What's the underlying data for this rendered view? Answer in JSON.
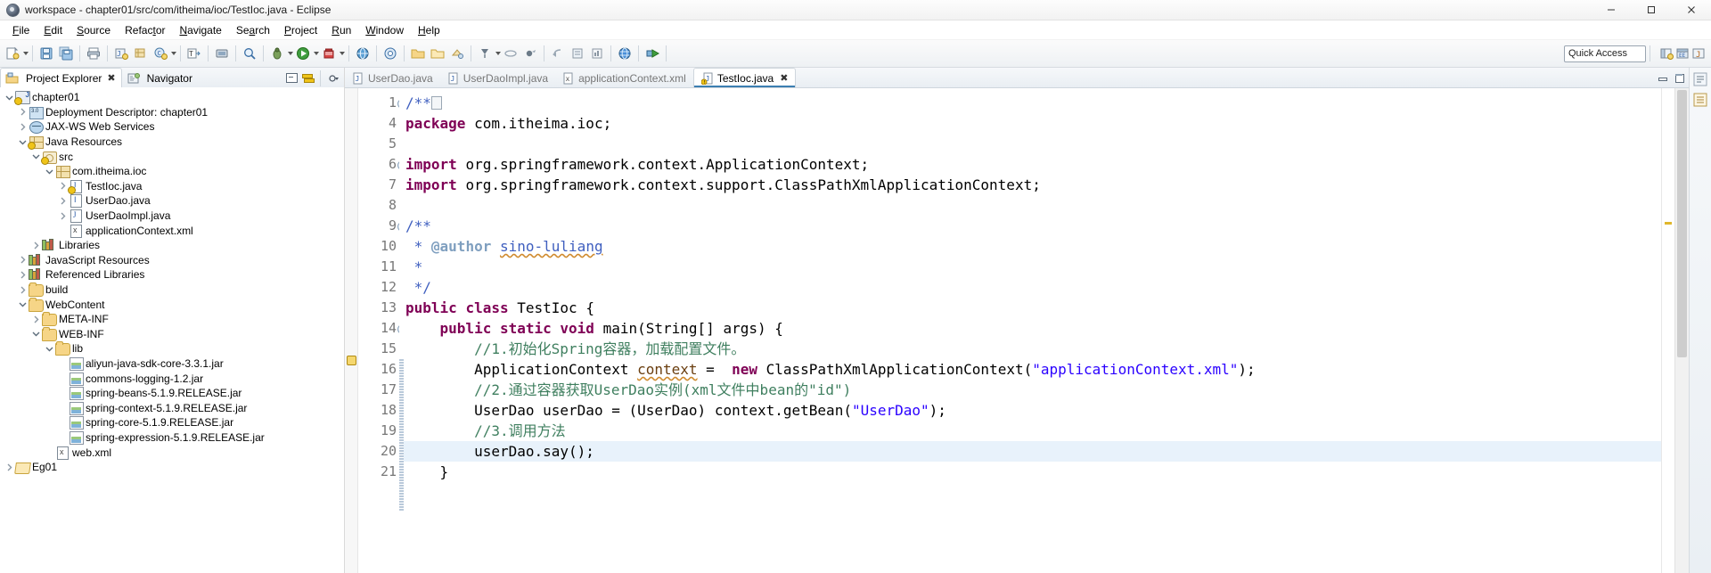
{
  "window": {
    "title": "workspace - chapter01/src/com/itheima/ioc/TestIoc.java - Eclipse",
    "app_icon": "eclipse-icon",
    "minimize_label": "Minimize",
    "maximize_label": "Maximize",
    "close_label": "Close"
  },
  "menubar": {
    "items": [
      {
        "label": "File",
        "mnemonic": "F"
      },
      {
        "label": "Edit",
        "mnemonic": "E"
      },
      {
        "label": "Source",
        "mnemonic": "S"
      },
      {
        "label": "Refactor",
        "mnemonic": "t"
      },
      {
        "label": "Navigate",
        "mnemonic": "N"
      },
      {
        "label": "Search",
        "mnemonic": "a"
      },
      {
        "label": "Project",
        "mnemonic": "P"
      },
      {
        "label": "Run",
        "mnemonic": "R"
      },
      {
        "label": "Window",
        "mnemonic": "W"
      },
      {
        "label": "Help",
        "mnemonic": "H"
      }
    ]
  },
  "toolbar": {
    "quick_access_placeholder": "Quick Access",
    "buttons": [
      {
        "name": "new-wizard-icon",
        "tooltip": "New"
      },
      {
        "name": "save-icon",
        "tooltip": "Save"
      },
      {
        "name": "save-all-icon",
        "tooltip": "Save All"
      },
      {
        "name": "print-icon",
        "tooltip": "Print"
      },
      {
        "name": "new-java-project-icon",
        "tooltip": "New Java Project"
      },
      {
        "name": "new-class-icon",
        "tooltip": "New Class"
      },
      {
        "name": "open-type-icon",
        "tooltip": "Open Type"
      },
      {
        "name": "build-all-icon",
        "tooltip": "Build All"
      },
      {
        "name": "debug-icon",
        "tooltip": "Debug"
      },
      {
        "name": "run-icon",
        "tooltip": "Run"
      },
      {
        "name": "run-external-tools-icon",
        "tooltip": "External Tools"
      },
      {
        "name": "new-server-icon",
        "tooltip": "New Server"
      },
      {
        "name": "new-ejb-icon",
        "tooltip": "New EJB"
      },
      {
        "name": "new-web-service-icon",
        "tooltip": "New Web Service"
      },
      {
        "name": "open-perspective-icon",
        "tooltip": "Open Perspective"
      },
      {
        "name": "search-icon",
        "tooltip": "Search"
      },
      {
        "name": "next-annotation-icon",
        "tooltip": "Next Annotation"
      },
      {
        "name": "previous-annotation-icon",
        "tooltip": "Previous Annotation"
      },
      {
        "name": "last-edit-location-icon",
        "tooltip": "Last Edit Location"
      },
      {
        "name": "back-icon",
        "tooltip": "Back"
      },
      {
        "name": "forward-icon",
        "tooltip": "Forward"
      }
    ],
    "perspective_icons": [
      {
        "name": "java-ee-perspective-icon"
      },
      {
        "name": "java-perspective-icon"
      },
      {
        "name": "open-perspective-button-icon"
      }
    ]
  },
  "left_panel": {
    "tabs": [
      {
        "label": "Project Explorer",
        "icon": "project-explorer-icon",
        "active": true,
        "closable": true
      },
      {
        "label": "Navigator",
        "icon": "navigator-icon",
        "active": false,
        "closable": false
      }
    ],
    "tab_actions": [
      {
        "name": "collapse-all-icon"
      },
      {
        "name": "link-with-editor-icon"
      },
      {
        "name": "view-menu-icon"
      }
    ],
    "tree": [
      {
        "label": "chapter01",
        "depth": 0,
        "twisty": "open",
        "icon": "java-web-project-icon",
        "warn": true
      },
      {
        "label": "Deployment Descriptor: chapter01",
        "depth": 1,
        "twisty": "closed",
        "icon": "deployment-descriptor-icon",
        "warn": false
      },
      {
        "label": "JAX-WS Web Services",
        "depth": 1,
        "twisty": "closed",
        "icon": "web-services-icon",
        "warn": false
      },
      {
        "label": "Java Resources",
        "depth": 1,
        "twisty": "open",
        "icon": "java-resources-icon",
        "warn": true
      },
      {
        "label": "src",
        "depth": 2,
        "twisty": "open",
        "icon": "source-folder-icon",
        "warn": true
      },
      {
        "label": "com.itheima.ioc",
        "depth": 3,
        "twisty": "open",
        "icon": "package-icon",
        "warn": false
      },
      {
        "label": "TestIoc.java",
        "depth": 4,
        "twisty": "closed",
        "icon": "java-class-file-icon",
        "warn": true
      },
      {
        "label": "UserDao.java",
        "depth": 4,
        "twisty": "closed",
        "icon": "java-interface-file-icon",
        "warn": false
      },
      {
        "label": "UserDaoImpl.java",
        "depth": 4,
        "twisty": "closed",
        "icon": "java-class-file-icon",
        "warn": false
      },
      {
        "label": "applicationContext.xml",
        "depth": 4,
        "twisty": "none",
        "icon": "xml-file-icon",
        "warn": false
      },
      {
        "label": "Libraries",
        "depth": 2,
        "twisty": "closed",
        "icon": "libraries-icon",
        "warn": false
      },
      {
        "label": "JavaScript Resources",
        "depth": 1,
        "twisty": "closed",
        "icon": "libraries-icon",
        "warn": false
      },
      {
        "label": "Referenced Libraries",
        "depth": 1,
        "twisty": "closed",
        "icon": "libraries-icon",
        "warn": false
      },
      {
        "label": "build",
        "depth": 1,
        "twisty": "closed",
        "icon": "folder-icon",
        "warn": false
      },
      {
        "label": "WebContent",
        "depth": 1,
        "twisty": "open",
        "icon": "folder-icon",
        "warn": false
      },
      {
        "label": "META-INF",
        "depth": 2,
        "twisty": "closed",
        "icon": "folder-icon",
        "warn": false
      },
      {
        "label": "WEB-INF",
        "depth": 2,
        "twisty": "open",
        "icon": "folder-icon",
        "warn": false
      },
      {
        "label": "lib",
        "depth": 3,
        "twisty": "open",
        "icon": "folder-icon",
        "warn": false
      },
      {
        "label": "aliyun-java-sdk-core-3.3.1.jar",
        "depth": 4,
        "twisty": "none",
        "icon": "jar-icon",
        "warn": false
      },
      {
        "label": "commons-logging-1.2.jar",
        "depth": 4,
        "twisty": "none",
        "icon": "jar-icon",
        "warn": false
      },
      {
        "label": "spring-beans-5.1.9.RELEASE.jar",
        "depth": 4,
        "twisty": "none",
        "icon": "jar-icon",
        "warn": false
      },
      {
        "label": "spring-context-5.1.9.RELEASE.jar",
        "depth": 4,
        "twisty": "none",
        "icon": "jar-icon",
        "warn": false
      },
      {
        "label": "spring-core-5.1.9.RELEASE.jar",
        "depth": 4,
        "twisty": "none",
        "icon": "jar-icon",
        "warn": false
      },
      {
        "label": "spring-expression-5.1.9.RELEASE.jar",
        "depth": 4,
        "twisty": "none",
        "icon": "jar-icon",
        "warn": false
      },
      {
        "label": "web.xml",
        "depth": 3,
        "twisty": "none",
        "icon": "xml-file-icon",
        "warn": false
      },
      {
        "label": "Eg01",
        "depth": 0,
        "twisty": "closed",
        "icon": "project-closed-icon",
        "warn": false
      }
    ]
  },
  "editor": {
    "tabs": [
      {
        "label": "UserDao.java",
        "icon": "java-file-icon",
        "active": false,
        "dirty": false
      },
      {
        "label": "UserDaoImpl.java",
        "icon": "java-file-icon",
        "active": false,
        "dirty": false
      },
      {
        "label": "applicationContext.xml",
        "icon": "xml-file-icon",
        "active": false,
        "dirty": false
      },
      {
        "label": "TestIoc.java",
        "icon": "java-file-warning-icon",
        "active": true,
        "dirty": false
      }
    ],
    "tab_actions": [
      {
        "name": "minimize-icon"
      },
      {
        "name": "maximize-icon"
      }
    ],
    "line_numbers": [
      "1",
      "4",
      "5",
      "6",
      "7",
      "8",
      "9",
      "10",
      "11",
      "12",
      "13",
      "14",
      "15",
      "16",
      "17",
      "18",
      "19",
      "20",
      "21"
    ],
    "lines": [
      {
        "num": "1",
        "fold": "collapsed",
        "kind": "folded-javadoc",
        "text": "/**"
      },
      {
        "num": "4",
        "fold": "none",
        "kind": "package",
        "text": "package com.itheima.ioc;"
      },
      {
        "num": "5",
        "fold": "none",
        "kind": "blank",
        "text": ""
      },
      {
        "num": "6",
        "fold": "expanded",
        "kind": "import",
        "text": "import org.springframework.context.ApplicationContext;"
      },
      {
        "num": "7",
        "fold": "none",
        "kind": "import",
        "text": "import org.springframework.context.support.ClassPathXmlApplicationContext;"
      },
      {
        "num": "8",
        "fold": "none",
        "kind": "blank",
        "text": ""
      },
      {
        "num": "9",
        "fold": "expanded",
        "kind": "javadoc",
        "text": "/**"
      },
      {
        "num": "10",
        "fold": "none",
        "kind": "javadoc-author",
        "text": " * @author sino-luliang"
      },
      {
        "num": "11",
        "fold": "none",
        "kind": "javadoc",
        "text": " *"
      },
      {
        "num": "12",
        "fold": "none",
        "kind": "javadoc",
        "text": " */"
      },
      {
        "num": "13",
        "fold": "none",
        "kind": "class-decl",
        "text": "public class TestIoc {"
      },
      {
        "num": "14",
        "fold": "expanded",
        "kind": "method-decl",
        "text": "    public static void main(String[] args) {"
      },
      {
        "num": "15",
        "fold": "none",
        "kind": "comment",
        "text": "        //1.初始化Spring容器，加载配置文件。"
      },
      {
        "num": "16",
        "fold": "none",
        "kind": "stmt-new-context",
        "text": "        ApplicationContext context =  new ClassPathXmlApplicationContext(\"applicationContext.xml\");"
      },
      {
        "num": "17",
        "fold": "none",
        "kind": "comment",
        "text": "        //2.通过容器获取UserDao实例(xml文件中bean的\"id\")"
      },
      {
        "num": "18",
        "fold": "none",
        "kind": "stmt-getbean",
        "text": "        UserDao userDao = (UserDao) context.getBean(\"UserDao\");"
      },
      {
        "num": "19",
        "fold": "none",
        "kind": "comment",
        "text": "        //3.调用方法"
      },
      {
        "num": "20",
        "fold": "none",
        "kind": "stmt-say",
        "text": "        userDao.say();",
        "highlighted": true
      },
      {
        "num": "21",
        "fold": "none",
        "kind": "close-brace",
        "text": "    }"
      }
    ],
    "tokens": {
      "package_kw": "package",
      "package_name": "com.itheima.ioc;",
      "import_kw": "import",
      "import1": "org.springframework.context.ApplicationContext;",
      "import2": "org.springframework.context.support.ClassPathXmlApplicationContext;",
      "javadoc_open": "/**",
      "javadoc_star": " *",
      "javadoc_close": " */",
      "author_tag": "@author",
      "author_name": "sino-luliang",
      "public_kw": "public",
      "class_kw": "class",
      "class_name": "TestIoc {",
      "static_kw": "static",
      "void_kw": "void",
      "main_sig": "main(String[] args) {",
      "comment1": "//1.初始化Spring容器，加载配置文件。",
      "type_appctx": "ApplicationContext",
      "var_context": "context",
      "equals": "=",
      "new_kw": "new",
      "ctor_call": "ClassPathXmlApplicationContext(",
      "xml_string": "\"applicationContext.xml\"",
      "ctor_end": ");",
      "comment2": "//2.通过容器获取UserDao实例(xml文件中bean的\"id\")",
      "type_userdao": "UserDao",
      "var_userdao": "userDao",
      "cast_userdao": "(UserDao)",
      "getbean_call": "context.getBean(",
      "bean_string": "\"UserDao\"",
      "getbean_end": ");",
      "comment3": "//3.调用方法",
      "say_call": "userDao.say();",
      "close_brace": "}"
    },
    "colors": {
      "keyword": "#7f0055",
      "string": "#2a00ff",
      "comment": "#3f7f5f",
      "javadoc": "#3f5fbf",
      "javadoc_tag": "#7f9fbf",
      "field": "#6a3e0f",
      "line_highlight": "#e8f2fb",
      "background": "#ffffff"
    }
  },
  "right_bar": {
    "items": [
      {
        "name": "outline-view-icon"
      },
      {
        "name": "task-list-icon"
      }
    ]
  }
}
